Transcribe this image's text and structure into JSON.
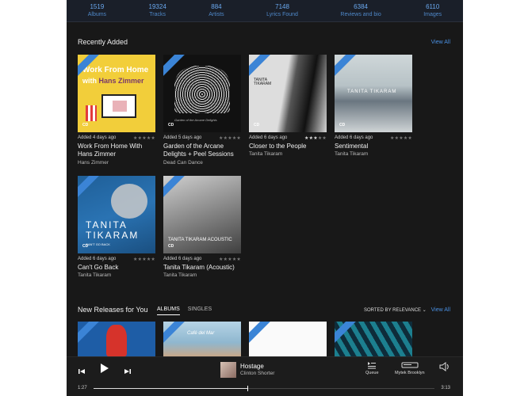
{
  "stats": [
    {
      "value": "1519",
      "label": "Albums"
    },
    {
      "value": "19324",
      "label": "Tracks"
    },
    {
      "value": "884",
      "label": "Artists"
    },
    {
      "value": "7148",
      "label": "Lyrics Found"
    },
    {
      "value": "6384",
      "label": "Reviews and bio"
    },
    {
      "value": "6110",
      "label": "Images"
    }
  ],
  "recently_added": {
    "title": "Recently Added",
    "view_all": "View All",
    "albums": [
      {
        "added": "Added 4 days ago",
        "title": "Work From Home With Hans Zimmer",
        "artist": "Hans Zimmer",
        "rating": 0,
        "format": "CD",
        "cover_text_1": "Work From Home",
        "cover_text_2a": "with ",
        "cover_text_2b": "Hans Zimmer"
      },
      {
        "added": "Added 5 days ago",
        "title": "Garden of the Arcane Delights + Peel Sessions",
        "artist": "Dead Can Dance",
        "rating": 0,
        "format": "CD",
        "cover_text": "Garden of the Arcane Delights"
      },
      {
        "added": "Added 6 days ago",
        "title": "Closer to the People",
        "artist": "Tanita Tikaram",
        "rating": 3,
        "format": "CD",
        "cover_text": "TANITA TIKARAM"
      },
      {
        "added": "Added 6 days ago",
        "title": "Sentimental",
        "artist": "Tanita Tikaram",
        "rating": 0,
        "format": "CD",
        "cover_text": "TANITA TIKARAM"
      },
      {
        "added": "Added 6 days ago",
        "title": "Can't Go Back",
        "artist": "Tanita Tikaram",
        "rating": 0,
        "format": "CD",
        "cover_text": "TANITA TIKARAM",
        "cover_sub": "CAN'T GO BACK"
      },
      {
        "added": "Added 6 days ago",
        "title": "Tanita Tikaram (Acoustic)",
        "artist": "Tanita Tikaram",
        "rating": 0,
        "format": "CD",
        "cover_text": "TANITA TIKARAM ACOUSTIC"
      }
    ]
  },
  "new_releases": {
    "title": "New Releases for You",
    "view_all": "View All",
    "tabs": [
      "ALBUMS",
      "SINGLES"
    ],
    "active_tab": "ALBUMS",
    "sort_label": "SORTED BY RELEVANCE",
    "strip2_text": "Café del Mar"
  },
  "player": {
    "track_title": "Hostage",
    "track_artist": "Clinton Shorter",
    "elapsed": "1:27",
    "duration": "3:13",
    "progress": 0.45,
    "queue_label": "Queue",
    "device_label": "Mytek Brooklyn"
  },
  "icons": {
    "prev": "skip-back-icon",
    "play": "play-icon",
    "next": "skip-forward-icon",
    "queue": "queue-icon",
    "device": "device-icon",
    "volume": "volume-icon"
  }
}
